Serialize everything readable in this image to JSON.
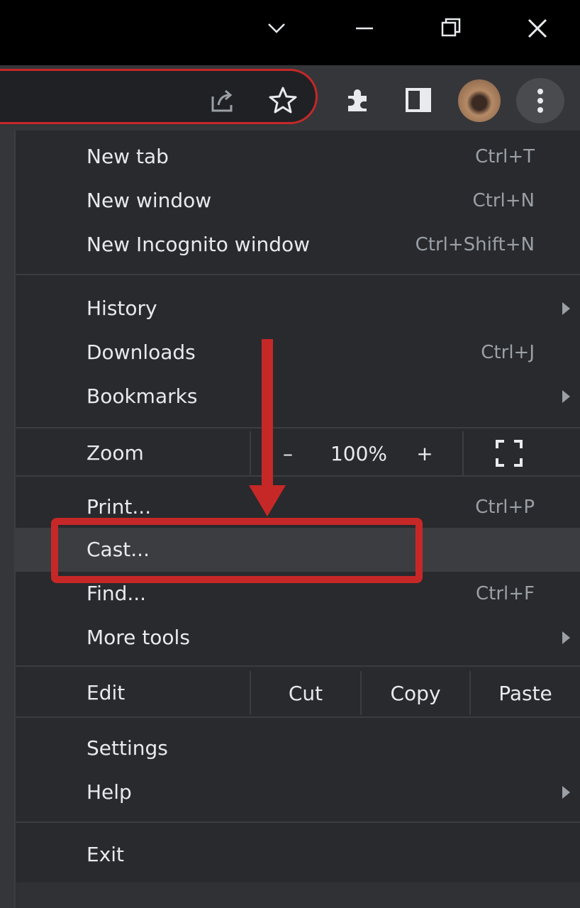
{
  "window": {
    "controls": [
      "tab-search",
      "minimize",
      "restore",
      "close"
    ]
  },
  "toolbar": {
    "icons": [
      "share-icon",
      "bookmark-star-icon",
      "extensions-icon",
      "side-panel-icon",
      "profile-avatar",
      "more-menu-icon"
    ]
  },
  "menu": {
    "new_tab": {
      "label": "New tab",
      "shortcut": "Ctrl+T"
    },
    "new_window": {
      "label": "New window",
      "shortcut": "Ctrl+N"
    },
    "new_incognito": {
      "label": "New Incognito window",
      "shortcut": "Ctrl+Shift+N"
    },
    "history": {
      "label": "History"
    },
    "downloads": {
      "label": "Downloads",
      "shortcut": "Ctrl+J"
    },
    "bookmarks": {
      "label": "Bookmarks"
    },
    "zoom": {
      "label": "Zoom",
      "minus": "–",
      "value": "100%",
      "plus": "+"
    },
    "print": {
      "label": "Print...",
      "shortcut": "Ctrl+P"
    },
    "cast": {
      "label": "Cast..."
    },
    "find": {
      "label": "Find...",
      "shortcut": "Ctrl+F"
    },
    "more_tools": {
      "label": "More tools"
    },
    "edit": {
      "label": "Edit",
      "cut": "Cut",
      "copy": "Copy",
      "paste": "Paste"
    },
    "settings": {
      "label": "Settings"
    },
    "help": {
      "label": "Help"
    },
    "exit": {
      "label": "Exit"
    }
  },
  "colors": {
    "annotation": "#c62828",
    "menu_bg": "#292a2d",
    "highlight": "#3c3d41"
  }
}
